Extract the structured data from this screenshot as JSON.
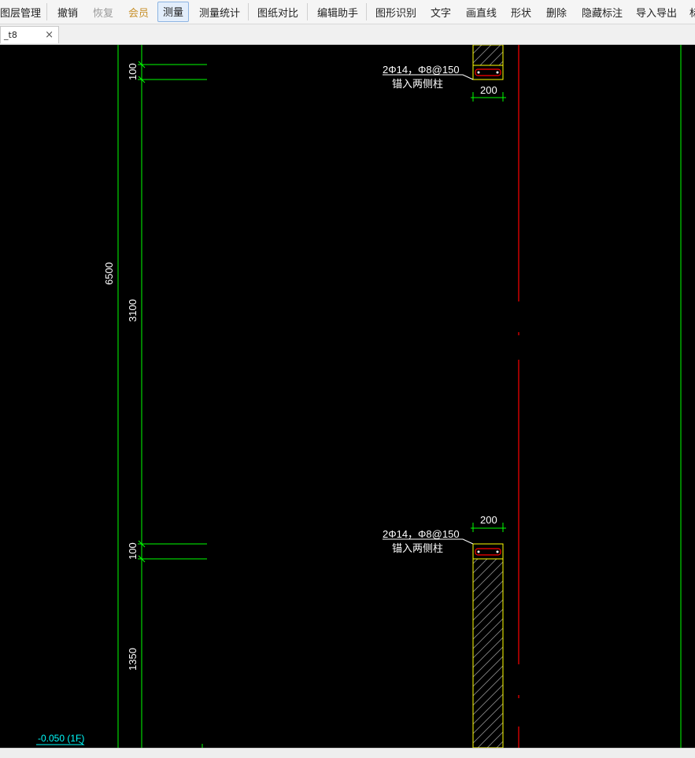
{
  "toolbar": {
    "items": [
      {
        "label": "图层管理",
        "state": "normal"
      },
      {
        "label": "撤销",
        "state": "normal"
      },
      {
        "label": "恢复",
        "state": "disabled"
      },
      {
        "label": "会员",
        "state": "member"
      },
      {
        "label": "测量",
        "state": "active"
      },
      {
        "label": "测量统计",
        "state": "normal"
      },
      {
        "label": "图纸对比",
        "state": "normal"
      },
      {
        "label": "编辑助手",
        "state": "normal"
      },
      {
        "label": "图形识别",
        "state": "normal"
      },
      {
        "label": "文字",
        "state": "normal"
      },
      {
        "label": "画直线",
        "state": "normal"
      },
      {
        "label": "形状",
        "state": "normal"
      },
      {
        "label": "删除",
        "state": "normal"
      },
      {
        "label": "隐藏标注",
        "state": "normal"
      },
      {
        "label": "导入导出",
        "state": "normal"
      },
      {
        "label": "标",
        "state": "normal"
      }
    ]
  },
  "tab": {
    "title": "_t8",
    "close_icon": "×"
  },
  "drawing": {
    "dimensions": {
      "top_small": "100",
      "total_height": "6500",
      "middle": "3100",
      "lower_small": "100",
      "bottom": "1350"
    },
    "beam_top": {
      "rebar_label": "2Φ14，Φ8@150",
      "note": "锚入两侧柱",
      "width": "200"
    },
    "beam_bottom": {
      "rebar_label": "2Φ14，Φ8@150",
      "note": "锚入两侧柱",
      "width": "200"
    },
    "elevation_label": "-0.050 (1F)"
  },
  "colors": {
    "canvas_bg": "#000000",
    "dim_line": "#00ff00",
    "grid_axis": "#ff0000",
    "column_outline": "#ffff00",
    "text": "#ffffff",
    "elevation": "#00ffff"
  }
}
